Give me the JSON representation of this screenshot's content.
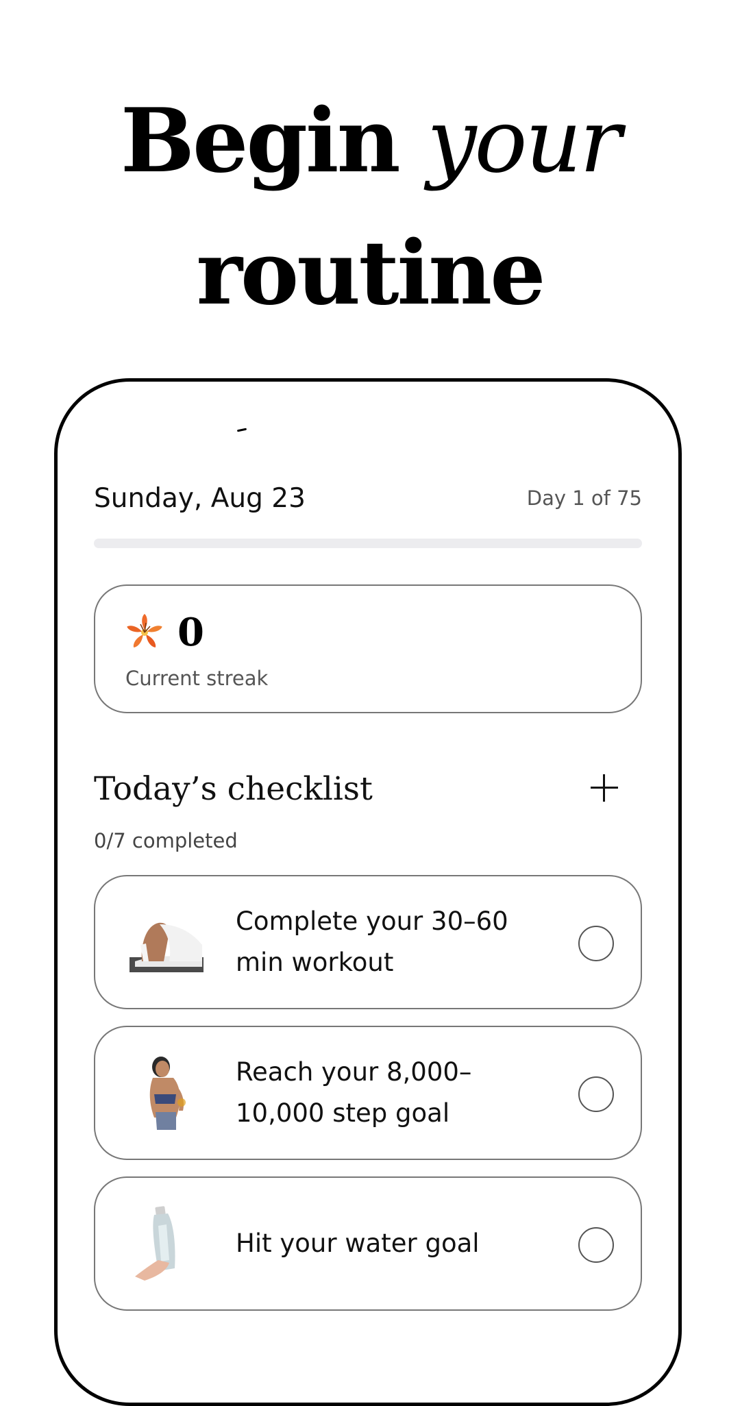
{
  "headline": {
    "line1_bold": "Begin",
    "line1_italic": "your",
    "line2": "routine"
  },
  "header": {
    "date": "Sunday, Aug 23",
    "day_count": "Day 1 of 75",
    "progress_fraction": 0
  },
  "streak": {
    "icon": "lily-flower-icon",
    "value": "0",
    "label": "Current streak"
  },
  "checklist": {
    "title": "Today’s checklist",
    "add_icon": "plus-icon",
    "completed": "0/7 completed",
    "tasks": [
      {
        "label": "Complete your 30–60 min workout",
        "icon": "workout-photo",
        "checked": false
      },
      {
        "label": "Reach your 8,000–10,000 step goal",
        "icon": "walking-photo",
        "checked": false
      },
      {
        "label": "Hit your water goal",
        "icon": "water-bottle-photo",
        "checked": false
      }
    ]
  },
  "colors": {
    "accent": "#000000",
    "muted_text": "#555555",
    "card_border": "#777777",
    "progress_track": "#ececef"
  }
}
